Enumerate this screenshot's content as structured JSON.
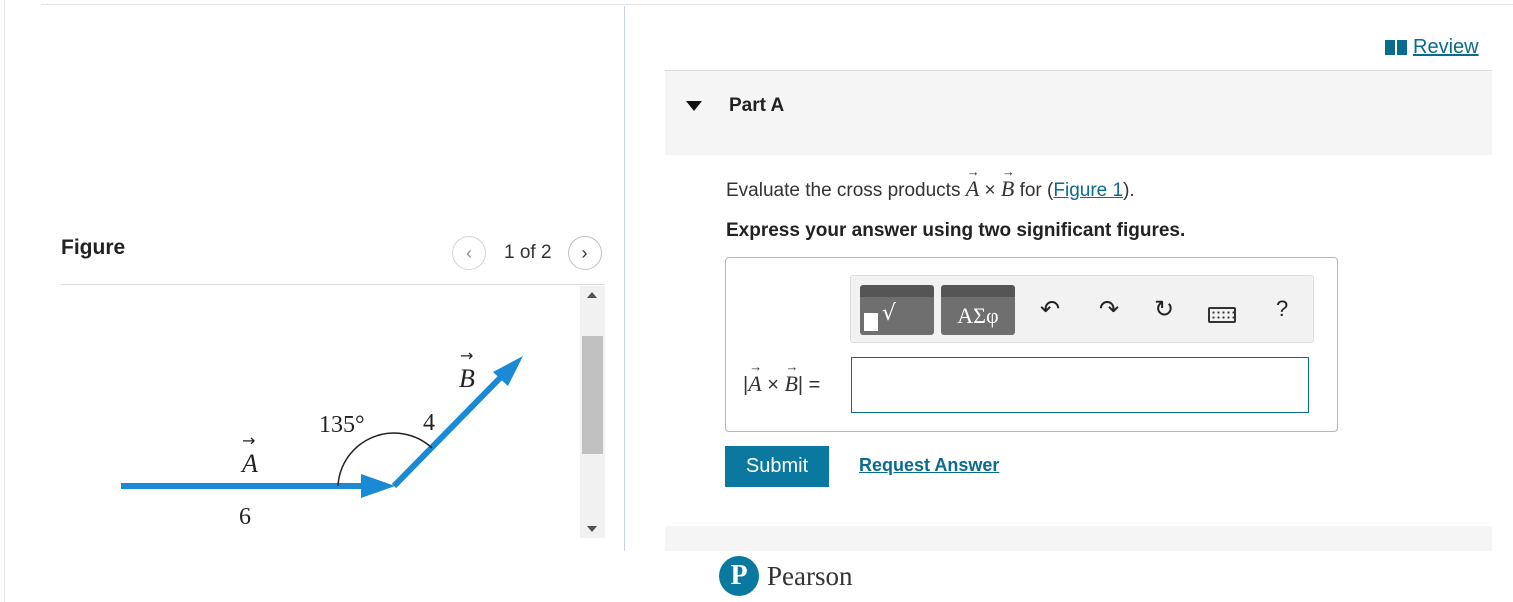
{
  "review": {
    "label": "Review"
  },
  "part": {
    "title": "Part A"
  },
  "question": {
    "prefix": "Evaluate the cross products ",
    "vec_a": "A",
    "cross": " × ",
    "vec_b": "B",
    "for": " for (",
    "figure_link": "Figure 1",
    "suffix": ")."
  },
  "instruction": "Express your answer using two significant figures.",
  "toolbar": {
    "template_root": "√",
    "greek": "ΑΣφ",
    "undo": "↶",
    "redo": "↷",
    "reset": "↻",
    "help": "?"
  },
  "equation": {
    "open": "|",
    "vec_a": "A",
    "times": " × ",
    "vec_b": "B",
    "close": "| ="
  },
  "answer": {
    "value": "",
    "placeholder": ""
  },
  "actions": {
    "submit": "Submit",
    "request": "Request Answer"
  },
  "figure": {
    "title": "Figure",
    "pager_prev": "‹",
    "pager_count": "1 of 2",
    "pager_next": "›",
    "labels": {
      "vec_a": "A",
      "vec_b": "B",
      "angle": "135°",
      "mag_a": "6",
      "mag_b": "4"
    },
    "arrow_color": "#1a8ad4"
  },
  "brand": {
    "logo_letter": "P",
    "name": "Pearson"
  }
}
